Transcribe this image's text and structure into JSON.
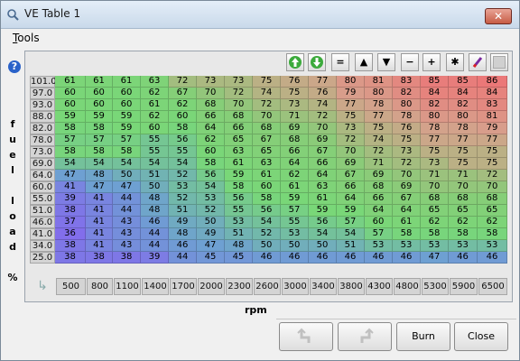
{
  "window": {
    "title": "VE Table 1",
    "close_glyph": "✕"
  },
  "menu": {
    "tools": "Tools"
  },
  "y_axis_label": "fuel load %",
  "x_axis_label": "rpm",
  "toolbar": [
    "arrow-up-icon",
    "arrow-down-icon",
    "=",
    "▲",
    "▼",
    "−",
    "+",
    "✱",
    "pen-icon",
    "square-icon"
  ],
  "rows": [
    "101.0",
    "97.0",
    "93.0",
    "88.0",
    "82.0",
    "78.0",
    "73.0",
    "69.0",
    "64.0",
    "60.0",
    "55.0",
    "51.0",
    "46.0",
    "41.0",
    "34.0",
    "25.0"
  ],
  "cols": [
    "500",
    "800",
    "1100",
    "1400",
    "1700",
    "2000",
    "2300",
    "2600",
    "3000",
    "3400",
    "3800",
    "4300",
    "4800",
    "5300",
    "5900",
    "6500"
  ],
  "values": [
    [
      61,
      61,
      61,
      63,
      72,
      73,
      73,
      75,
      76,
      77,
      80,
      81,
      83,
      85,
      85,
      86
    ],
    [
      60,
      60,
      60,
      62,
      67,
      70,
      72,
      74,
      75,
      76,
      79,
      80,
      82,
      84,
      84,
      84
    ],
    [
      60,
      60,
      60,
      61,
      62,
      68,
      70,
      72,
      73,
      74,
      77,
      78,
      80,
      82,
      82,
      83
    ],
    [
      59,
      59,
      59,
      62,
      60,
      66,
      68,
      70,
      71,
      72,
      75,
      77,
      78,
      80,
      80,
      81
    ],
    [
      58,
      58,
      59,
      60,
      58,
      64,
      66,
      68,
      69,
      70,
      73,
      75,
      76,
      78,
      78,
      79
    ],
    [
      57,
      57,
      57,
      55,
      56,
      62,
      65,
      67,
      68,
      69,
      72,
      74,
      75,
      77,
      77,
      77
    ],
    [
      58,
      58,
      58,
      55,
      55,
      60,
      63,
      65,
      66,
      67,
      70,
      72,
      73,
      75,
      75,
      75
    ],
    [
      54,
      54,
      54,
      54,
      54,
      58,
      61,
      63,
      64,
      66,
      69,
      71,
      72,
      73,
      75,
      75
    ],
    [
      47,
      48,
      50,
      51,
      52,
      56,
      59,
      61,
      62,
      64,
      67,
      69,
      70,
      71,
      71,
      72
    ],
    [
      41,
      47,
      47,
      50,
      53,
      54,
      58,
      60,
      61,
      63,
      66,
      68,
      69,
      70,
      70,
      70
    ],
    [
      39,
      41,
      44,
      48,
      52,
      53,
      56,
      58,
      59,
      61,
      64,
      66,
      67,
      68,
      68,
      68
    ],
    [
      38,
      41,
      44,
      48,
      51,
      52,
      55,
      56,
      57,
      59,
      59,
      64,
      64,
      65,
      65,
      65
    ],
    [
      37,
      41,
      43,
      46,
      49,
      50,
      53,
      54,
      55,
      56,
      57,
      60,
      61,
      62,
      62,
      62
    ],
    [
      36,
      41,
      43,
      44,
      48,
      49,
      51,
      52,
      53,
      54,
      54,
      57,
      58,
      58,
      58,
      58
    ],
    [
      38,
      41,
      43,
      44,
      46,
      47,
      48,
      50,
      50,
      50,
      51,
      53,
      53,
      53,
      53,
      53
    ],
    [
      38,
      38,
      38,
      39,
      44,
      45,
      45,
      46,
      46,
      46,
      46,
      46,
      46,
      47,
      46,
      46
    ]
  ],
  "buttons": {
    "undo": "undo-icon",
    "redo": "redo-icon",
    "burn": "Burn",
    "close": "Close"
  }
}
